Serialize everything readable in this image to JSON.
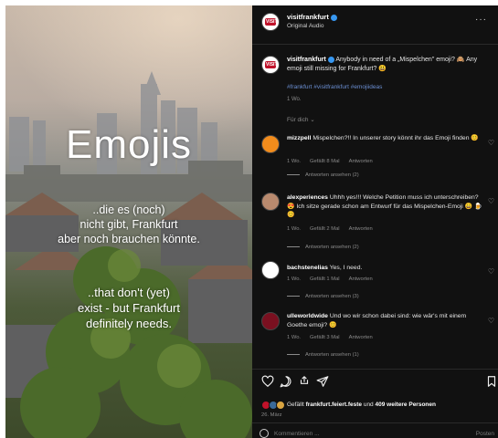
{
  "media": {
    "title": "Emojis",
    "de_lines": [
      "..die es (noch)",
      "nicht gibt, Frankfurt",
      "aber noch brauchen könnte."
    ],
    "en_lines": [
      "..that don't (yet)",
      "exist - but Frankfurt",
      "definitely needs."
    ]
  },
  "header": {
    "username": "visitfrankfurt",
    "audio": "Original Audio",
    "more": "···"
  },
  "caption": {
    "username": "visitfrankfurt",
    "text": "Anybody in need of a „Mispelchen\" emoji? 🙈 Any emoji still missing for Frankfurt? 😃",
    "hashtags": "#frankfurt #visitfrankfurt #emojiideas",
    "age": "1 Wo.",
    "sort_label": "Für dich ⌄"
  },
  "comments": [
    {
      "username": "mizzpell",
      "text": "Mispelchen?!! In unserer story könnt ihr das Emoji finden 😊",
      "age": "1 Wo.",
      "likes": "Gefällt 8 Mal",
      "reply": "Antworten",
      "view_replies": "Antworten ansehen (2)"
    },
    {
      "username": "alexperiences",
      "text": "Uhhh yes!!! Welche Petition muss ich unterschreiben? 😍 Ich sitze gerade schon am Entwurf für das Mispelchen-Emoji 😄 🍺 😊",
      "age": "1 Wo.",
      "likes": "Gefällt 2 Mal",
      "reply": "Antworten",
      "view_replies": "Antworten ansehen (2)"
    },
    {
      "username": "bachstenelias",
      "text": "Yes, I need.",
      "age": "1 Wo.",
      "likes": "Gefällt 1 Mal",
      "reply": "Antworten",
      "view_replies": "Antworten ansehen (3)"
    },
    {
      "username": "ulleworldwide",
      "text": "Und wo wir schon dabei sind: wie wär's mit einem Goethe emoji? 😊",
      "age": "1 Wo.",
      "likes": "Gefällt 3 Mal",
      "reply": "Antworten",
      "view_replies": "Antworten ansehen (1)"
    }
  ],
  "likes": {
    "prefix": "Gefällt",
    "user": "frankfurt.feiert.feste",
    "middle": "und",
    "others": "409 weitere Personen"
  },
  "date": "26. März",
  "comment_input": {
    "placeholder": "Kommentieren ...",
    "post_label": "Posten"
  },
  "colors": {
    "brand_red": "#c0122a",
    "verified_blue": "#3797f0",
    "panel_bg": "#111111",
    "hashtag": "#6b8fd3"
  },
  "icons": [
    "heart-icon",
    "comment-icon",
    "share-icon",
    "send-icon",
    "bookmark-icon",
    "emoji-icon"
  ]
}
